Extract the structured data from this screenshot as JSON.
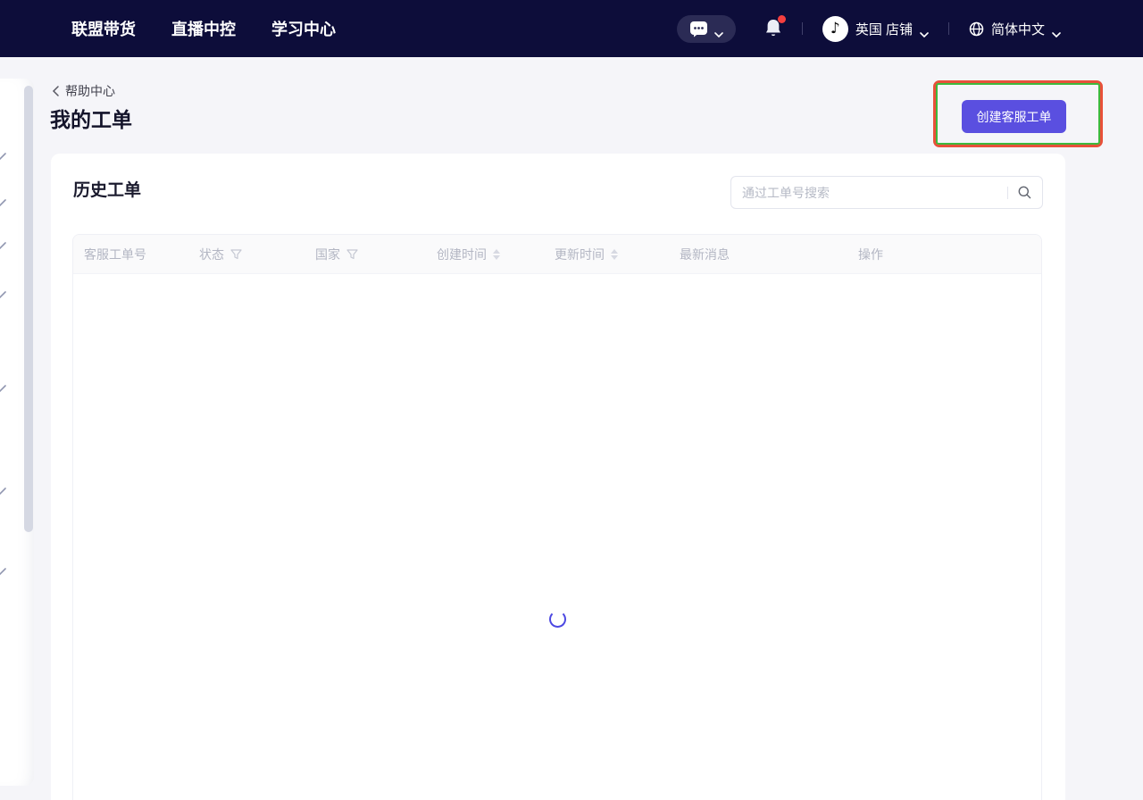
{
  "navbar": {
    "tabs": [
      {
        "label": "联盟带货"
      },
      {
        "label": "直播中控"
      },
      {
        "label": "学习中心"
      }
    ],
    "shop_label": "英国 店铺",
    "language_label": "简体中文"
  },
  "breadcrumb": {
    "back_label": "帮助中心"
  },
  "page": {
    "title": "我的工单"
  },
  "actions": {
    "create_ticket_label": "创建客服工单"
  },
  "panel": {
    "title": "历史工单",
    "search": {
      "placeholder": "通过工单号搜索",
      "value": ""
    }
  },
  "table": {
    "columns": [
      {
        "label": "客服工单号",
        "control": "none"
      },
      {
        "label": "状态",
        "control": "filter"
      },
      {
        "label": "国家",
        "control": "filter"
      },
      {
        "label": "创建时间",
        "control": "sort"
      },
      {
        "label": "更新时间",
        "control": "sort"
      },
      {
        "label": "最新消息",
        "control": "none"
      },
      {
        "label": "操作",
        "control": "none"
      }
    ],
    "rows": [],
    "state": "loading"
  },
  "colors": {
    "navbar_bg": "#0d0d3a",
    "primary_button": "#5a4fe0",
    "annotation_outer": "#e8503a",
    "annotation_inner": "#3db93d",
    "spinner": "#4c48e2",
    "notification_dot": "#f53f3f",
    "page_bg": "#f5f5f9"
  }
}
